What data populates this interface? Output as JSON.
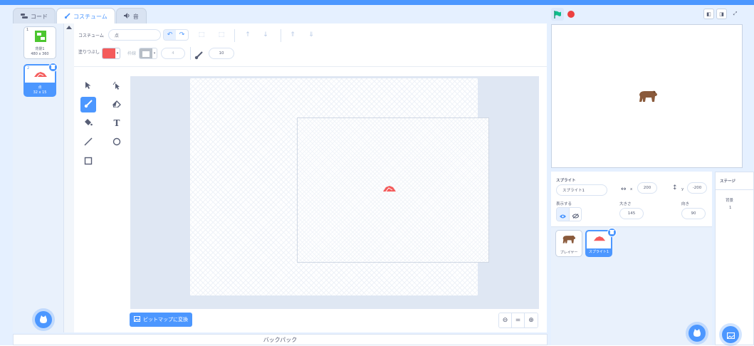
{
  "tabs": [
    {
      "label": "コード"
    },
    {
      "label": "コスチューム"
    },
    {
      "label": "音"
    }
  ],
  "costumes": [
    {
      "num": "1",
      "name": "背景1",
      "size": "480 x 360"
    },
    {
      "num": "2",
      "name": "点",
      "size": "32 x 15"
    }
  ],
  "editor": {
    "costume_label": "コスチューム",
    "costume_name": "点",
    "fill_label": "塗りつぶし",
    "outline_label": "枠線",
    "outline_width": "4",
    "brush_size": "10",
    "fill_color": "#f45b5b",
    "convert_label": "ビットマップに変換",
    "zoom": {
      "out": "−",
      "reset": "=",
      "in": "+"
    }
  },
  "backpack": {
    "label": "バックパック"
  },
  "sprite_info": {
    "sprite_label": "スプライト",
    "sprite_name": "スプライト1",
    "x_label": "x",
    "x_value": "200",
    "y_label": "y",
    "y_value": "-200",
    "show_label": "表示する",
    "size_label": "大きさ",
    "size_value": "145",
    "direction_label": "向き",
    "direction_value": "90"
  },
  "sprites": [
    {
      "name": "プレイヤー"
    },
    {
      "name": "スプライト1"
    }
  ],
  "stage_panel": {
    "title": "ステージ",
    "backdrops_label": "背景",
    "backdrops_count": "1"
  },
  "colors": {
    "accent": "#4c97ff",
    "stop": "#ec4040",
    "flag": "#0fbd8c",
    "bear": "#8a5a3b",
    "paint": "#f45b5b"
  }
}
